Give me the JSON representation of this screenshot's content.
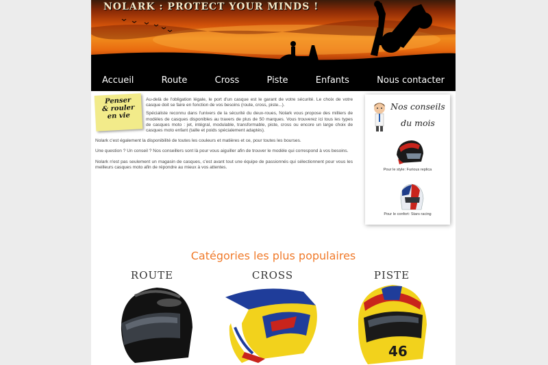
{
  "header": {
    "site_title": "NOLARK : PROTECT YOUR MINDS !"
  },
  "nav": {
    "items": [
      "Accueil",
      "Route",
      "Cross",
      "Piste",
      "Enfants",
      "Nous contacter"
    ]
  },
  "postit": {
    "line1": "Penser",
    "line2": "& rouler",
    "line3": "en vie"
  },
  "intro": {
    "p1": "Au-delà de l'obligation légale, le port d'un casque est le garant de votre sécurité. Le choix de votre casque doit se faire en fonction de vos besoins (route, cross, piste...).",
    "p2": "Spécialiste reconnu dans l'univers de la sécurité du deux-roues, Nolark vous propose des milliers de modèles de casques disponibles au travers de plus de 50 marques. Vous trouverez ici tous les types de casques moto : jet, intégral, modulable, transformable, piste, cross ou encore un large choix de casques moto enfant (taille et poids spécialement adaptés).",
    "p3": "Nolark c'est également la disponibilité de toutes les couleurs et matières et ce, pour toutes les bourses.",
    "p4": "Une question ? Un conseil ? Nos conseillers sont là pour vous aiguiller afin de trouver le modèle qui correspond à vos besoins.",
    "p5": "Nolark n'est pas seulement un magasin de casques, c'est avant tout une équipe de passionnés qui sélectionnent pour vous les meilleurs casques moto afin de répondre au mieux à vos attentes."
  },
  "advice": {
    "title_line1": "Nos conseils",
    "title_line2": "du mois",
    "item1_caption": "Pour le style: Furious replica",
    "item2_caption": "Pour le confort: Stars racing"
  },
  "categories": {
    "title": "Catégories les plus populaires",
    "items": [
      {
        "label": "ROUTE",
        "icon": "black-road-helmet"
      },
      {
        "label": "CROSS",
        "icon": "yellow-blue-cross-helmet"
      },
      {
        "label": "PISTE",
        "icon": "yellow-racing-helmet"
      }
    ]
  },
  "colors": {
    "accent": "#f07a2a",
    "sunset_orange": "#e96b0f",
    "nav_bg": "#000000",
    "postit": "#f2eb8a"
  }
}
